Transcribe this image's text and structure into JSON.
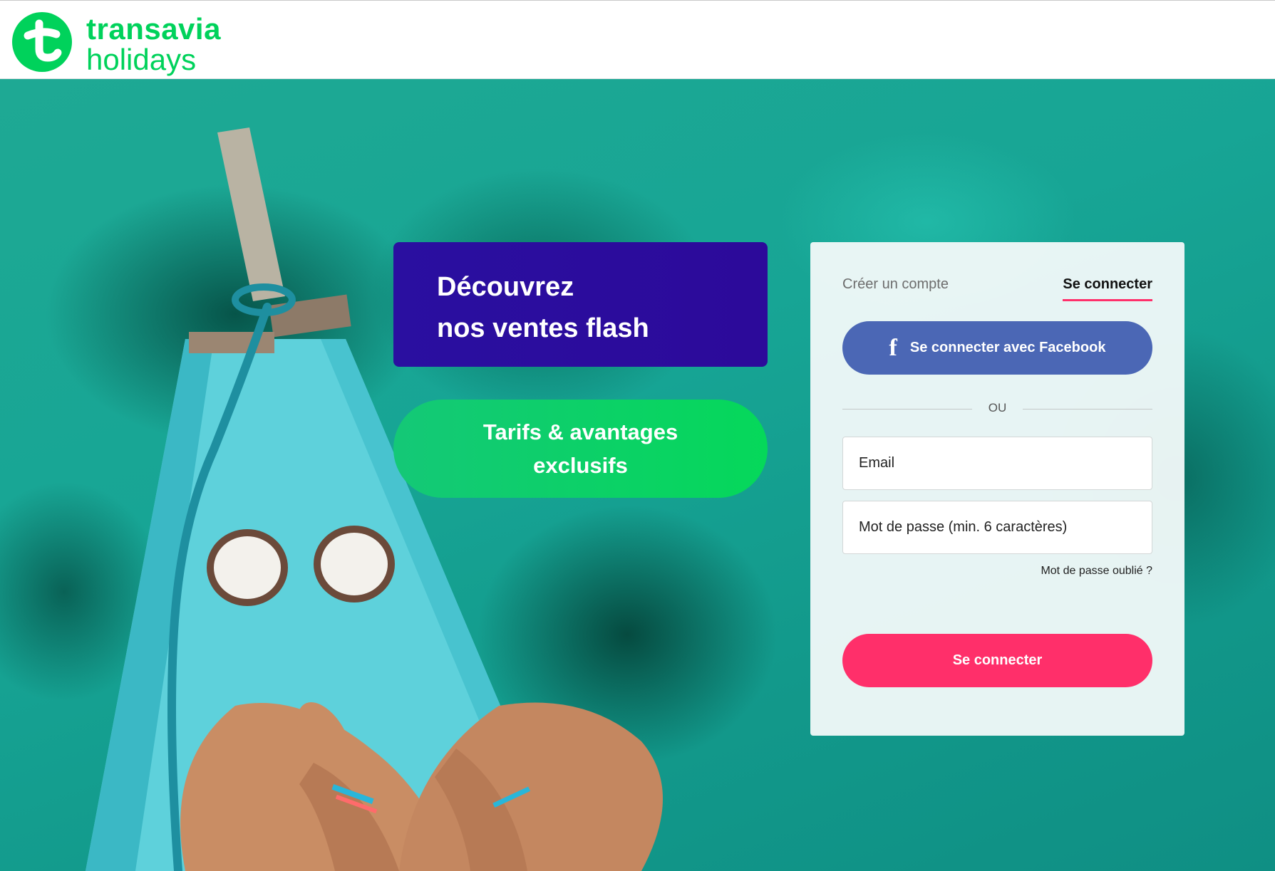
{
  "header": {
    "logo_line1": "transavia",
    "logo_line2": "holidays",
    "logo_icon": "t-icon"
  },
  "hero": {
    "flash_card": {
      "line1": "Découvrez",
      "line2": "nos ventes flash"
    },
    "tarifs_pill": {
      "line1": "Tarifs & avantages",
      "line2": "exclusifs"
    }
  },
  "login": {
    "tabs": {
      "create": "Créer un compte",
      "login": "Se connecter"
    },
    "facebook_button": "Se connecter avec Facebook",
    "facebook_icon": "f",
    "divider": "OU",
    "email_placeholder": "Email",
    "password_placeholder": "Mot de passe (min. 6 caractères)",
    "forgot_password": "Mot de passe oublié ?",
    "submit": "Se connecter"
  },
  "colors": {
    "brand_green": "#00d25b",
    "flash_card_blue": "#2a0fa0",
    "facebook_blue": "#4b67b5",
    "accent_pink": "#ff2f6a"
  }
}
